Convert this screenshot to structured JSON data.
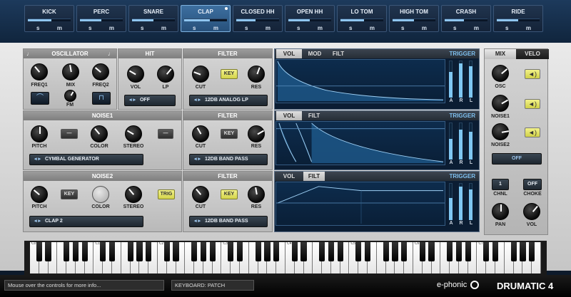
{
  "pads": [
    {
      "name": "KICK",
      "s": "s",
      "m": "m",
      "level": 0.55
    },
    {
      "name": "PERC",
      "s": "s",
      "m": "m",
      "level": 0.5
    },
    {
      "name": "SNARE",
      "s": "s",
      "m": "m",
      "level": 0.5
    },
    {
      "name": "CLAP",
      "s": "s",
      "m": "m",
      "level": 0.6,
      "active": true
    },
    {
      "name": "CLOSED HH",
      "s": "s",
      "m": "m",
      "level": 0.45
    },
    {
      "name": "OPEN HH",
      "s": "s",
      "m": "m",
      "level": 0.5
    },
    {
      "name": "LO TOM",
      "s": "s",
      "m": "m",
      "level": 0.55
    },
    {
      "name": "HIGH TOM",
      "s": "s",
      "m": "m",
      "level": 0.5
    },
    {
      "name": "CRASH",
      "s": "s",
      "m": "m",
      "level": 0.45
    },
    {
      "name": "RIDE",
      "s": "s",
      "m": "m",
      "level": 0.5
    }
  ],
  "osc": {
    "title": "OSCILLATOR",
    "note_icon": "music-note-icon",
    "freq1": "FREQ1",
    "mix": "MIX",
    "freq2": "FREQ2",
    "fm": "FM",
    "wave1_icon": "sine-wave-icon",
    "wave2_icon": "square-wave-icon"
  },
  "hit": {
    "title": "HIT",
    "vol": "VOL",
    "lp": "LP",
    "select": "OFF"
  },
  "filter1": {
    "title": "FILTER",
    "key": "KEY",
    "cut": "CUT",
    "res": "RES",
    "select": "12DB ANALOG LP"
  },
  "noise1": {
    "title": "NOISE1",
    "pitch": "PITCH",
    "color": "COLOR",
    "stereo": "STEREO",
    "select": "CYMBAL GENERATOR"
  },
  "filter2": {
    "title": "FILTER",
    "key": "KEY",
    "cut": "CUT",
    "res": "RES",
    "select": "12DB BAND PASS"
  },
  "noise2": {
    "title": "NOISE2",
    "pitch": "PITCH",
    "key": "KEY",
    "color": "COLOR",
    "stereo": "STEREO",
    "trig": "TRIG",
    "select": "CLAP 2"
  },
  "filter3": {
    "title": "FILTER",
    "key": "KEY",
    "cut": "CUT",
    "res": "RES",
    "select": "12DB BAND PASS"
  },
  "env1": {
    "tabs": [
      "VOL",
      "MOD",
      "FILT"
    ],
    "active": 0,
    "trigger": "TRIGGER",
    "meters": [
      "A",
      "R",
      "L"
    ],
    "levels": [
      0.7,
      0.92,
      0.85
    ]
  },
  "env2": {
    "tabs": [
      "VOL",
      "FILT"
    ],
    "active": 0,
    "trigger": "TRIGGER",
    "meters": [
      "A",
      "R",
      "L"
    ],
    "levels": [
      0.55,
      0.8,
      0.75
    ]
  },
  "env3": {
    "tabs": [
      "VOL",
      "FILT"
    ],
    "active": 1,
    "trigger": "TRIGGER",
    "meters": [
      "A",
      "R",
      "L"
    ],
    "levels": [
      0.6,
      0.9,
      0.82
    ]
  },
  "mix": {
    "tabs": [
      "MIX",
      "VELO"
    ],
    "osc": "OSC",
    "noise1": "NOISE1",
    "noise2": "NOISE2",
    "speaker_icon": "speaker-icon",
    "off_button": "OFF",
    "chnl_value": "1",
    "chnl": "CHNL",
    "choke_value": "OFF",
    "choke": "CHOKE",
    "pan": "PAN",
    "vol": "VOL"
  },
  "keyboard": {
    "octaves": [
      "C0",
      "C1",
      "C2",
      "C3",
      "C4",
      "C5",
      "C6",
      "C7"
    ]
  },
  "status": {
    "info": "Mouse over the controls for more info...",
    "keyboard_mode": "KEYBOARD: PATCH",
    "brand": "e-phonic",
    "product": "DRUMATIC 4"
  }
}
